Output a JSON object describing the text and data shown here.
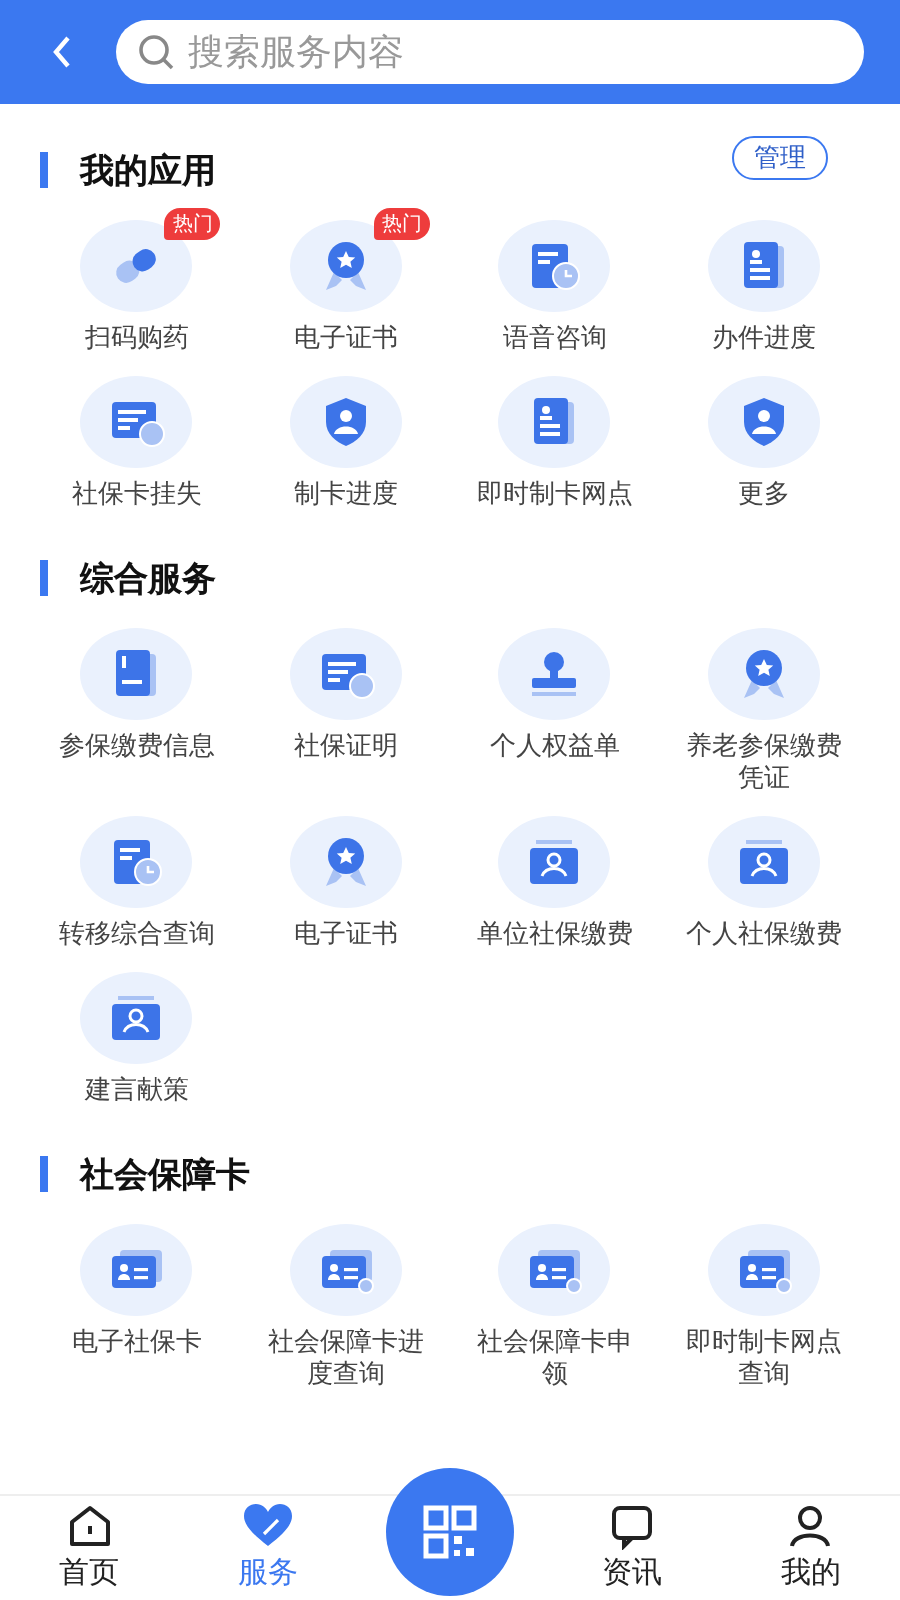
{
  "header": {
    "search": {
      "placeholder": "搜索服务内容"
    }
  },
  "sections": [
    {
      "title": "我的应用",
      "action": "管理",
      "items": [
        {
          "label": "扫码购药",
          "kind": "pill",
          "badge": "热门"
        },
        {
          "label": "电子证书",
          "kind": "medal",
          "badge": "热门"
        },
        {
          "label": "语音咨询",
          "kind": "doc-clock"
        },
        {
          "label": "办件进度",
          "kind": "profile-doc"
        },
        {
          "label": "社保卡挂失",
          "kind": "card-form"
        },
        {
          "label": "制卡进度",
          "kind": "shield"
        },
        {
          "label": "即时制卡网点",
          "kind": "profile-doc"
        },
        {
          "label": "更多",
          "kind": "shield"
        }
      ]
    },
    {
      "title": "综合服务",
      "items": [
        {
          "label": "参保缴费信息",
          "kind": "book"
        },
        {
          "label": "社保证明",
          "kind": "card-form"
        },
        {
          "label": "个人权益单",
          "kind": "stamp"
        },
        {
          "label": "养老参保缴费凭证",
          "kind": "medal"
        },
        {
          "label": "转移综合查询",
          "kind": "doc-clock"
        },
        {
          "label": "电子证书",
          "kind": "medal"
        },
        {
          "label": "单位社保缴费",
          "kind": "folder"
        },
        {
          "label": "个人社保缴费",
          "kind": "folder"
        },
        {
          "label": "建言献策",
          "kind": "folder"
        }
      ]
    },
    {
      "title": "社会保障卡",
      "items": [
        {
          "label": "电子社保卡",
          "kind": "id-card"
        },
        {
          "label": "社会保障卡进度查询",
          "kind": "id-card-dot"
        },
        {
          "label": "社会保障卡申领",
          "kind": "id-card-dot"
        },
        {
          "label": "即时制卡网点查询",
          "kind": "id-card-dot"
        }
      ]
    }
  ],
  "nav": [
    {
      "label": "首页",
      "kind": "home",
      "selected": false
    },
    {
      "label": "服务",
      "kind": "heart",
      "selected": true
    },
    {
      "kind": "qr"
    },
    {
      "label": "资讯",
      "kind": "chat",
      "selected": false
    },
    {
      "label": "我的",
      "kind": "person",
      "selected": false
    }
  ]
}
